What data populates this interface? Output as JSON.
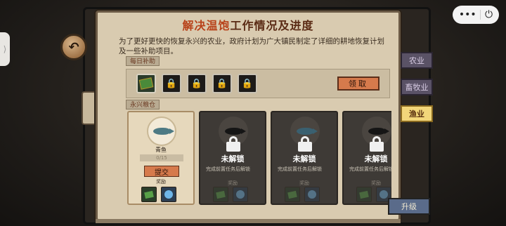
{
  "title": {
    "highlight": "解决温饱",
    "rest": "工作情况及进度"
  },
  "description": "为了更好更快的恢复永兴的农业，政府计划为广大镇民制定了详细的耕地恢复计划及一些补助项目。",
  "daily": {
    "label": "每日补助",
    "claim_label": "领取",
    "slots": [
      "book-icon",
      "lock-icon",
      "lock-icon",
      "lock-icon",
      "lock-icon"
    ]
  },
  "fishing": {
    "label": "永兴粮仓",
    "cards": [
      {
        "state": "open",
        "name": "青鱼",
        "progress": "0/15",
        "submit_label": "提交",
        "reward_label": "奖励"
      },
      {
        "state": "locked",
        "title": "未解锁",
        "desc": "完成前置任务后解锁",
        "reward_label": "奖励"
      },
      {
        "state": "locked",
        "title": "未解锁",
        "desc": "完成前置任务后解锁",
        "reward_label": "奖励"
      },
      {
        "state": "locked",
        "title": "未解锁",
        "desc": "完成前置任务后解锁",
        "reward_label": "奖励"
      }
    ]
  },
  "tabs": [
    {
      "label": "农业",
      "active": false
    },
    {
      "label": "畜牧业",
      "active": false
    },
    {
      "label": "渔业",
      "active": true
    }
  ],
  "bottom_button": "升级",
  "top_controls": {
    "more": "•••",
    "power": "⏻"
  },
  "side_tab": "⟩",
  "back_button": "↶"
}
